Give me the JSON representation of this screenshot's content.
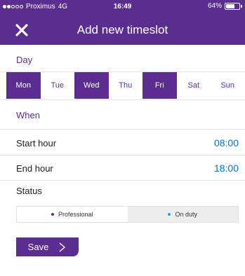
{
  "status_bar": {
    "carrier": "Proximus",
    "network": "4G",
    "time": "16:49",
    "battery": "64%",
    "battery_level": 0.64
  },
  "header": {
    "title": "Add new timeslot",
    "close_icon": "close-icon",
    "background": "#5c2d91"
  },
  "day_section": {
    "label": "Day",
    "days": [
      {
        "label": "Mon",
        "selected": true
      },
      {
        "label": "Tue",
        "selected": false
      },
      {
        "label": "Wed",
        "selected": true
      },
      {
        "label": "Thu",
        "selected": false
      },
      {
        "label": "Fri",
        "selected": true
      },
      {
        "label": "Sat",
        "selected": false
      },
      {
        "label": "Sun",
        "selected": false
      }
    ]
  },
  "when_section": {
    "label": "When",
    "start_label": "Start hour",
    "start_value": "08:00",
    "end_label": "End hour",
    "end_value": "18:00"
  },
  "status_section": {
    "label": "Status",
    "options": [
      {
        "label": "Professional",
        "dot_color": "#5c2d91",
        "active": false
      },
      {
        "label": "On duty",
        "dot_color": "#1ea7d6",
        "active": true
      }
    ]
  },
  "save_button": {
    "label": "Save",
    "icon": "chevron-right-icon"
  },
  "colors": {
    "accent": "#5c2d91",
    "link": "#0072c6"
  }
}
